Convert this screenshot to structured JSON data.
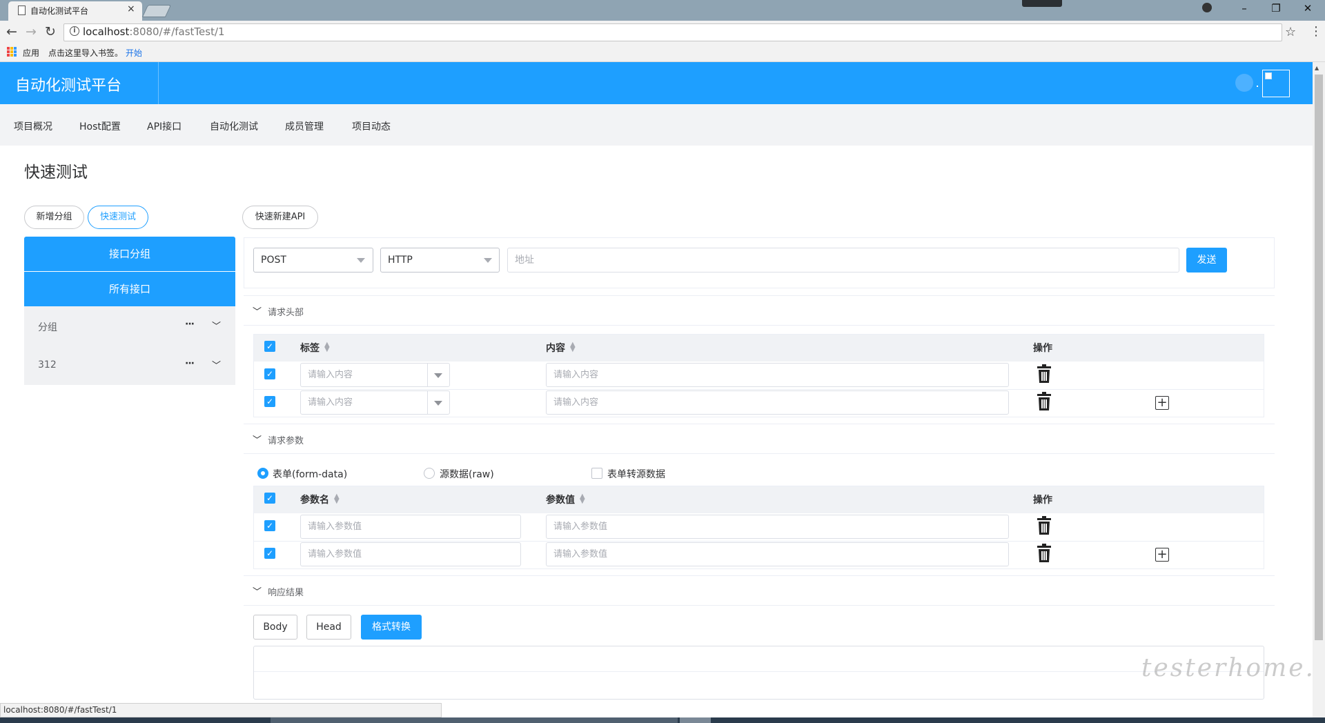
{
  "browser": {
    "tab_title": "自动化测试平台",
    "tab_close": "×",
    "url_host": "localhost",
    "url_path": ":8080/#/fastTest/1",
    "bookmarks": {
      "apps": "应用",
      "import_hint": "点击这里导入书签。",
      "start": "开始"
    },
    "status_url": "localhost:8080/#/fastTest/1"
  },
  "header": {
    "logo": "自动化测试平台"
  },
  "subnav": {
    "items": [
      "项目概况",
      "Host配置",
      "API接口",
      "自动化测试",
      "成员管理",
      "项目动态"
    ]
  },
  "page": {
    "title": "快速测试",
    "btn_new_group": "新增分组",
    "btn_fast_test": "快速测试",
    "btn_new_api": "快速新建API"
  },
  "sidebar": {
    "group_header": "接口分组",
    "all_apis": "所有接口",
    "items": [
      {
        "label": "分组",
        "dots": "···"
      },
      {
        "label": "312",
        "dots": "···"
      }
    ]
  },
  "request": {
    "method": "POST",
    "protocol": "HTTP",
    "address_placeholder": "地址",
    "send": "发送"
  },
  "headers_section": {
    "title": "请求头部",
    "col_label": "标签",
    "col_content": "内容",
    "col_action": "操作",
    "rows": [
      {
        "label_placeholder": "请输入内容",
        "content_placeholder": "请输入内容"
      },
      {
        "label_placeholder": "请输入内容",
        "content_placeholder": "请输入内容"
      }
    ]
  },
  "params_section": {
    "title": "请求参数",
    "radio_form": "表单(form-data)",
    "radio_raw": "源数据(raw)",
    "checkbox_convert": "表单转源数据",
    "col_name": "参数名",
    "col_value": "参数值",
    "col_action": "操作",
    "rows": [
      {
        "name_placeholder": "请输入参数值",
        "value_placeholder": "请输入参数值"
      },
      {
        "name_placeholder": "请输入参数值",
        "value_placeholder": "请输入参数值"
      }
    ]
  },
  "response_section": {
    "title": "响应结果",
    "btn_body": "Body",
    "btn_head": "Head",
    "btn_format": "格式转换"
  },
  "watermark": "testerhome.com",
  "colors": {
    "primary": "#1e9fff",
    "subnav_bg": "#f2f3f5",
    "sidebar_bg": "#f0f1f3"
  }
}
